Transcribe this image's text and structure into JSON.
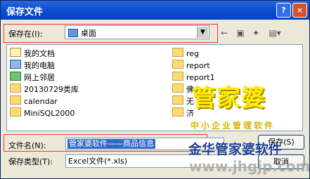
{
  "dialog": {
    "title": "保存文件",
    "help": "?",
    "close": "×"
  },
  "location": {
    "label": "保存在(I):",
    "value": "桌面"
  },
  "toolbar": {
    "back": "←",
    "up": "▣",
    "newfolder": "✦",
    "views": "▤▾"
  },
  "files": [
    {
      "name": "我的文档",
      "icon": "document-folder-icon"
    },
    {
      "name": "我的电脑",
      "icon": "computer-icon"
    },
    {
      "name": "网上邻居",
      "icon": "network-icon"
    },
    {
      "name": "20130729类库",
      "icon": "folder-icon"
    },
    {
      "name": "calendar",
      "icon": "folder-icon"
    },
    {
      "name": "MiniSQL2000",
      "icon": "folder-icon"
    },
    {
      "name": "reg",
      "icon": "folder-icon"
    },
    {
      "name": "report",
      "icon": "folder-icon"
    },
    {
      "name": "report1",
      "icon": "folder-icon"
    },
    {
      "name": "佛",
      "icon": "folder-icon"
    },
    {
      "name": "无",
      "icon": "folder-icon"
    },
    {
      "name": "济",
      "icon": "folder-icon"
    }
  ],
  "filename": {
    "label": "文件名(N):",
    "value": "管家婆软件——商品信息"
  },
  "filetype": {
    "label": "保存类型(T):",
    "value": "Excel文件(*.xls)"
  },
  "buttons": {
    "save": "保存(S)",
    "cancel": "取消"
  },
  "watermark": {
    "big": "管家婆",
    "small": "中小企业管理软件",
    "brand": "金华管家婆软件",
    "url": "www.jhgjp.com"
  }
}
